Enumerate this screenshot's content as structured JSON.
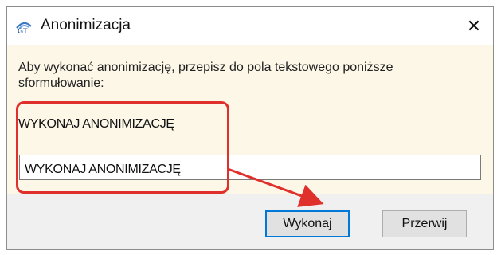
{
  "window": {
    "title": "Anonimizacja",
    "close_glyph": "✕"
  },
  "dialog": {
    "instruction": "Aby wykonać anonimizację, przepisz do pola tekstowego poniższe sformułowanie:",
    "phrase": "WYKONAJ ANONIMIZACJĘ",
    "input_value": "WYKONAJ ANONIMIZACJĘ"
  },
  "buttons": {
    "confirm_label": "Wykonaj",
    "cancel_label": "Przerwij"
  },
  "annotation": {
    "color": "#e0302c"
  },
  "icons": {
    "app": "app-logo-icon",
    "close": "close-icon"
  }
}
